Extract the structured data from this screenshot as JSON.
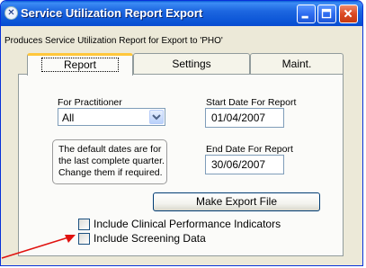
{
  "window": {
    "title": "Service Utilization Report Export",
    "description": "Produces Service Utilization Report for Export to 'PHO'"
  },
  "titlebar_buttons": {
    "minimize_icon": "minimize-icon",
    "maximize_icon": "maximize-icon",
    "close_icon": "close-icon"
  },
  "tabs": [
    {
      "label": "Report",
      "active": true
    },
    {
      "label": "Settings",
      "active": false
    },
    {
      "label": "Maint.",
      "active": false
    }
  ],
  "report": {
    "practitioner_label": "For Practitioner",
    "practitioner_value": "All",
    "start_label": "Start Date For Report",
    "start_value": "01/04/2007",
    "end_label": "End Date For Report",
    "end_value": "30/06/2007",
    "note_lines": [
      "The default dates are for",
      "the last complete quarter.",
      "Change them if required."
    ],
    "export_button": "Make Export File",
    "checkboxes": [
      {
        "label": "Include Clinical Performance Indicators",
        "checked": false
      },
      {
        "label": "Include Screening Data",
        "checked": false
      }
    ]
  },
  "colors": {
    "title_bar": "#0a5fd6",
    "annotation_arrow": "#e0120f",
    "active_tab_highlight": "#ffc73c"
  }
}
